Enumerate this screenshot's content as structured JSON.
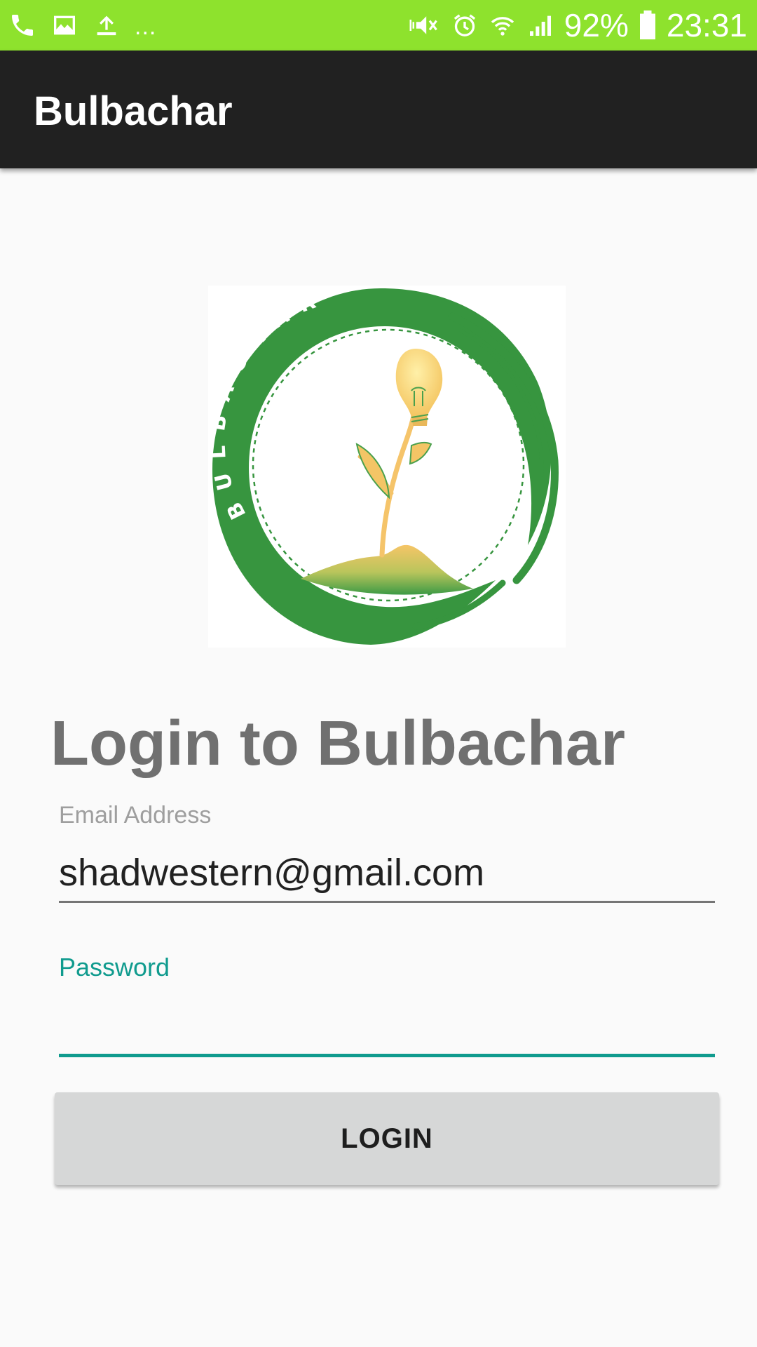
{
  "status_bar": {
    "background_color": "#8ee22d",
    "left_icons": [
      "phone-icon",
      "image-icon",
      "upload-icon"
    ],
    "overflow_text": "...",
    "right_icons": [
      "mute-icon",
      "alarm-icon",
      "wifi-icon",
      "signal-icon",
      "battery-icon"
    ],
    "battery": "92%",
    "time": "23:31"
  },
  "app_bar": {
    "title": "Bulbachar",
    "background_color": "#212121"
  },
  "logo": {
    "text": "BULBACHAR",
    "icon": "bulb-plant-logo",
    "ring_color": "#37953f"
  },
  "login_form": {
    "heading": "Login to Bulbachar",
    "email_label": "Email Address",
    "email_value": "shadwestern@gmail.com",
    "password_label": "Password",
    "password_value": "",
    "accent_color": "#109b8e",
    "submit_label": "LOGIN"
  }
}
